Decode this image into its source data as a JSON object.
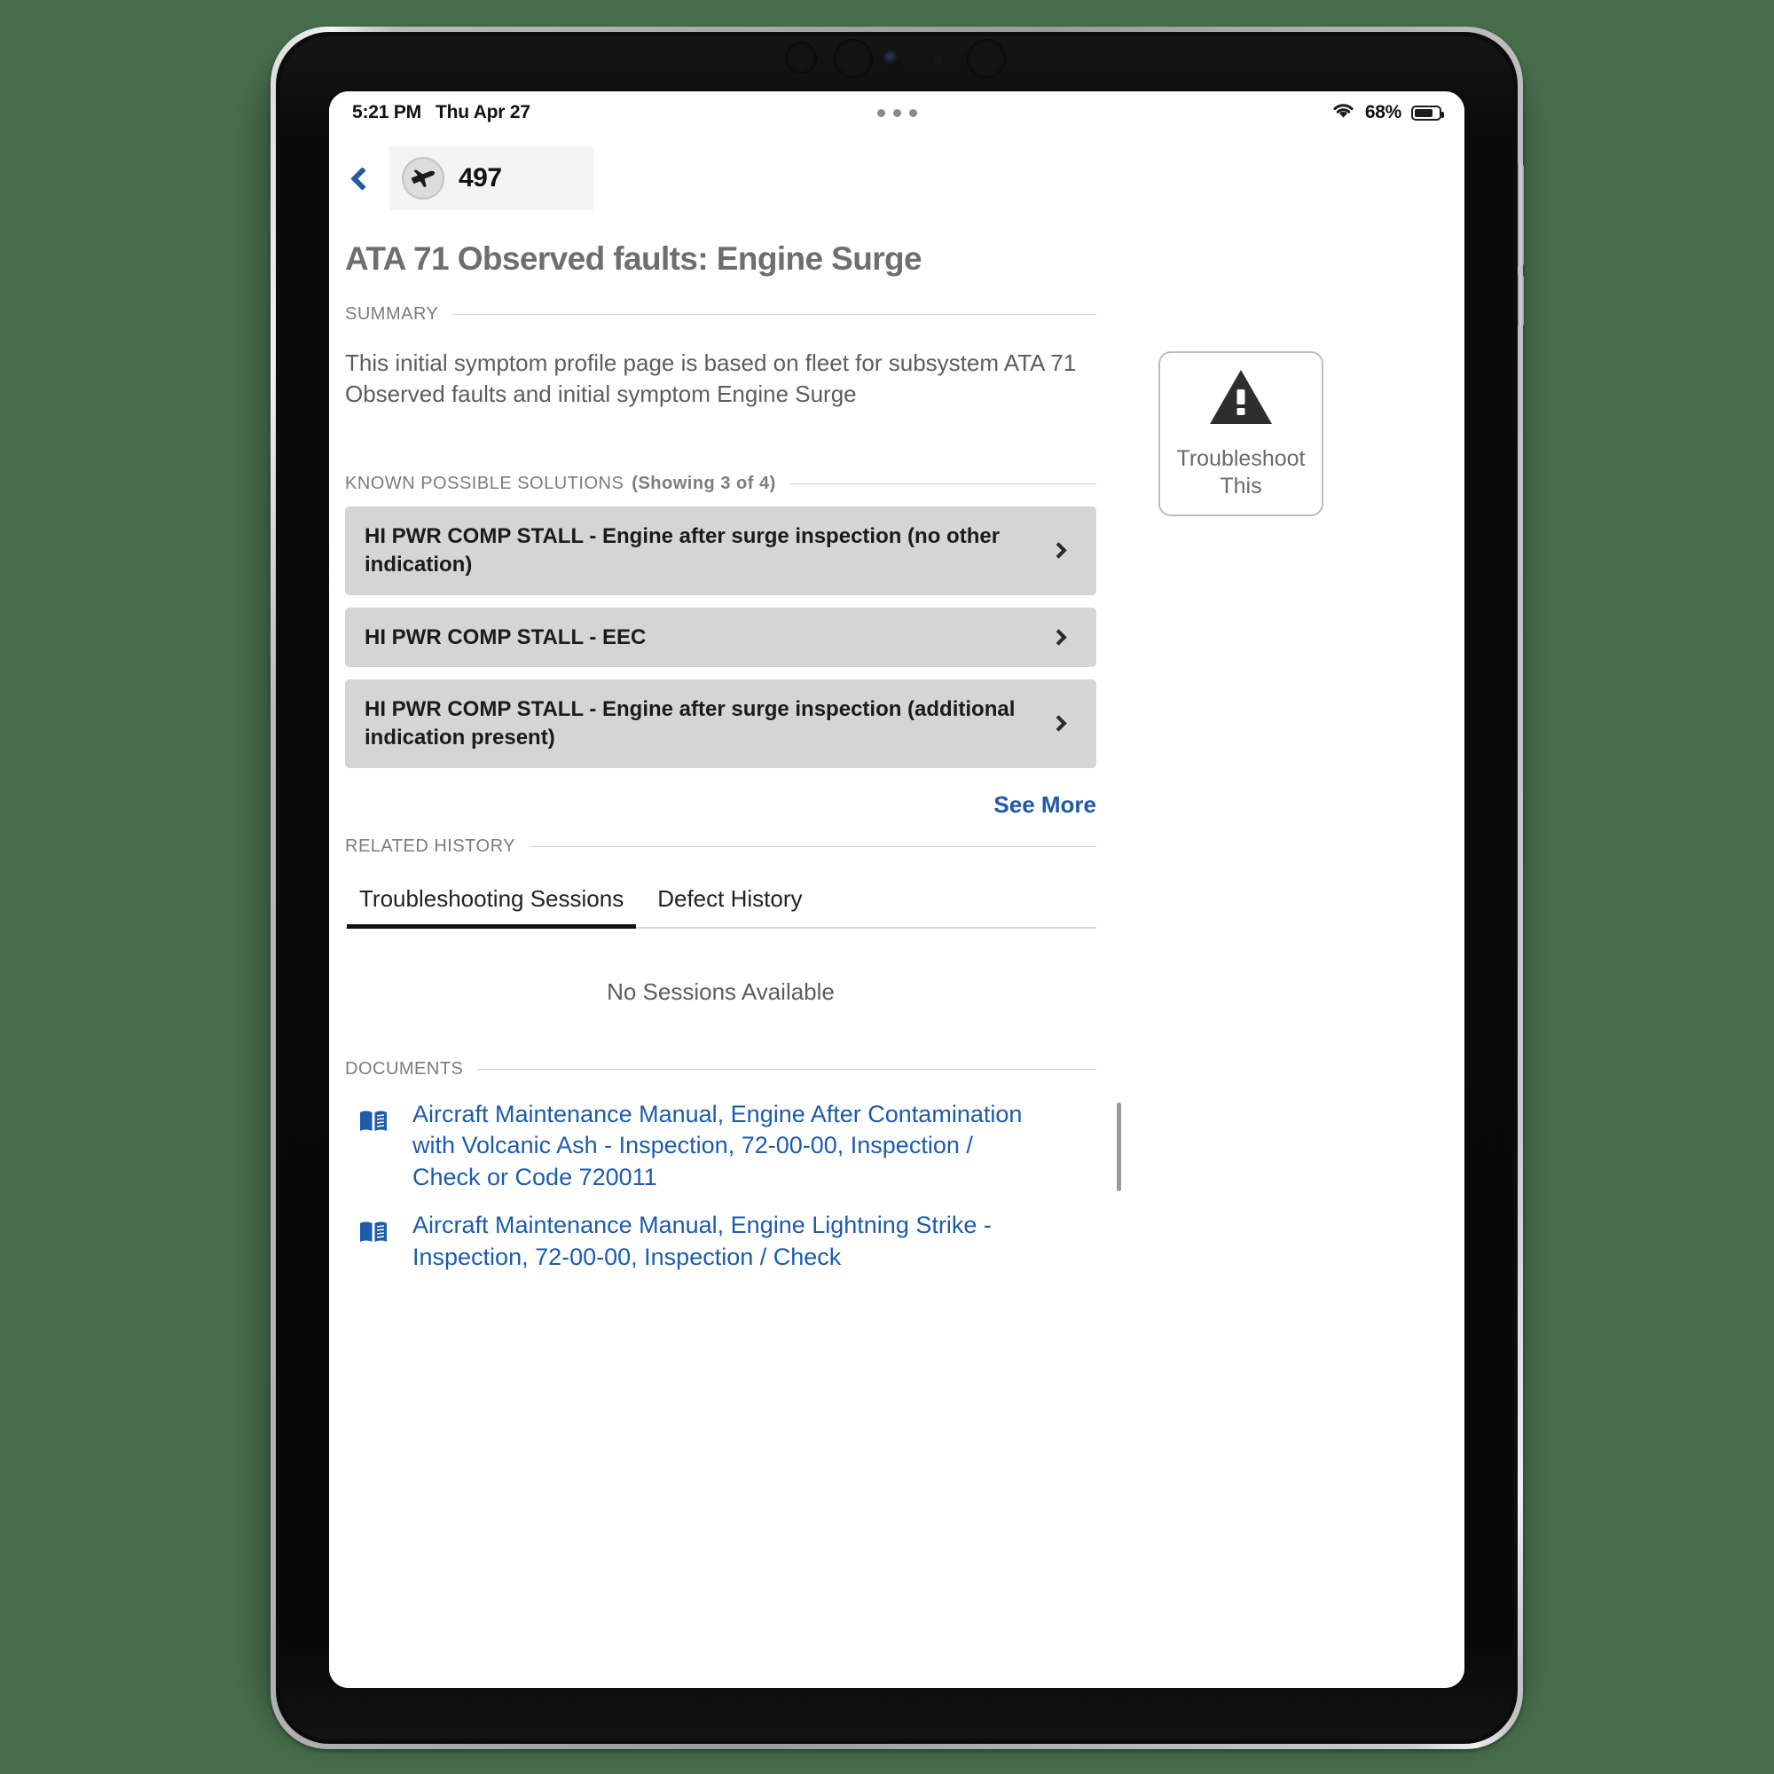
{
  "device": {
    "name": "iPad Pro"
  },
  "statusbar": {
    "time": "5:21 PM",
    "date": "Thu Apr 27",
    "wifi_icon": "wifi-icon",
    "battery_percent": "68%",
    "battery_level": 68,
    "multitask_icon": "multitask-dots-icon"
  },
  "appbar": {
    "back_icon": "chevron-left-icon",
    "aircraft_icon": "airplane-icon",
    "aircraft_number": "497"
  },
  "page": {
    "title": "ATA 71 Observed faults: Engine Surge"
  },
  "summary": {
    "label": "SUMMARY",
    "text": "This initial symptom profile page is based on fleet for subsystem ATA 71 Observed faults and initial symptom Engine Surge"
  },
  "solutions": {
    "label": "KNOWN POSSIBLE SOLUTIONS",
    "count_label": "(Showing 3 of 4)",
    "items": [
      {
        "text": "HI PWR COMP STALL - Engine after surge inspection (no other indication)",
        "chevron_icon": "chevron-right-icon"
      },
      {
        "text": "HI PWR COMP STALL - EEC",
        "chevron_icon": "chevron-right-icon"
      },
      {
        "text": "HI PWR COMP STALL - Engine after surge inspection (additional indication present)",
        "chevron_icon": "chevron-right-icon"
      }
    ],
    "see_more": "See More"
  },
  "related_history": {
    "label": "RELATED HISTORY",
    "tabs": [
      {
        "label": "Troubleshooting Sessions",
        "active": true
      },
      {
        "label": "Defect History",
        "active": false
      }
    ],
    "empty_text": "No Sessions Available"
  },
  "documents": {
    "label": "DOCUMENTS",
    "items": [
      {
        "icon": "book-icon",
        "title": "Aircraft Maintenance Manual, Engine After Contamination with Volcanic Ash - Inspection, 72-00-00, Inspection / Check or Code 720011"
      },
      {
        "icon": "book-icon",
        "title": "Aircraft Maintenance Manual, Engine Lightning Strike - Inspection, 72-00-00, Inspection / Check"
      }
    ]
  },
  "troubleshoot": {
    "icon": "warning-triangle-icon",
    "label": "Troubleshoot This"
  },
  "colors": {
    "background": "#486f4d",
    "link": "#1c5cab",
    "accent_blue": "#2159a8",
    "card": "#d5d5d5",
    "title_gray": "#6e6e6e"
  }
}
